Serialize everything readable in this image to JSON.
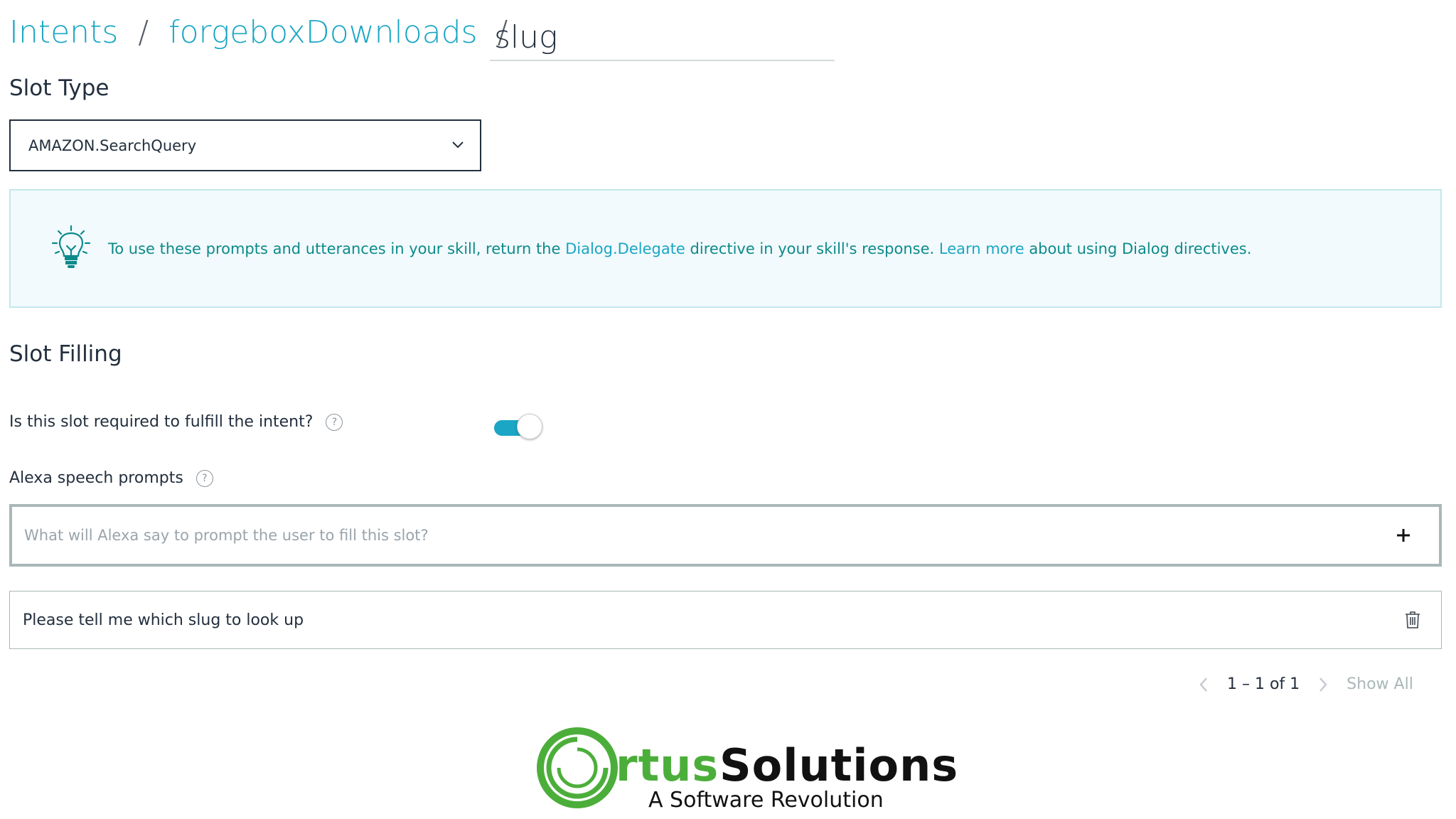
{
  "breadcrumb": {
    "intents": "Intents",
    "separator": "/",
    "intent_name": "forgeboxDownloads",
    "slot_name": "slug"
  },
  "slot_type": {
    "title": "Slot Type",
    "selected": "AMAZON.SearchQuery"
  },
  "info": {
    "text_before": "To use these prompts and utterances in your skill, return the ",
    "dialog_delegate_link": "Dialog.Delegate",
    "text_middle": " directive in your skill's response. ",
    "learn_more_link": "Learn more",
    "text_after": " about using Dialog directives.",
    "icon": "lightbulb-icon"
  },
  "slot_filling": {
    "title": "Slot Filling",
    "required_question": "Is this slot required to fulfill the intent?",
    "required": true,
    "speech_prompts_label": "Alexa speech prompts",
    "prompt_placeholder": "What will Alexa say to prompt the user to fill this slot?",
    "prompts": [
      "Please tell me which slug to look up"
    ]
  },
  "pagination": {
    "range": "1 – 1 of 1",
    "show_all": "Show All"
  },
  "logo": {
    "brand_rest": "rtus",
    "brand_second": "Solutions",
    "tagline": "A Software Revolution",
    "brand_color": "#4cae3a"
  },
  "colors": {
    "accent": "#1aa6c4",
    "info_text": "#0d8a8a",
    "info_bg": "#f2fafd"
  }
}
